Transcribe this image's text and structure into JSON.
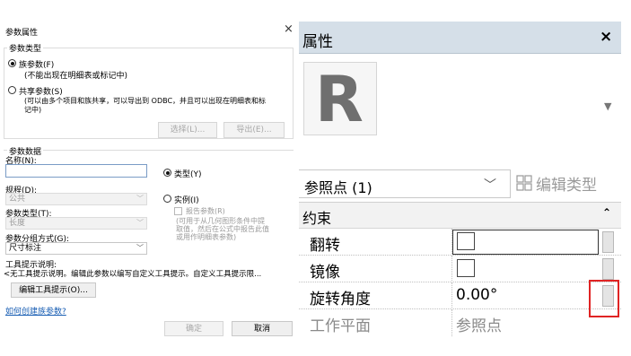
{
  "dialog": {
    "title": "参数属性",
    "close_glyph": "×",
    "param_type_group": "参数类型",
    "family_param": "族参数(F)",
    "family_param_note": "(不能出现在明细表或标记中)",
    "shared_param": "共享参数(S)",
    "shared_param_note_line1": "(可以由多个项目和族共享，可以导出到 ODBC，并且可以出现在明细表和标",
    "shared_param_note_line2": "记中)",
    "select_button": "选择(L)...",
    "export_button": "导出(E)...",
    "param_data_group": "参数数据",
    "name_label": "名称(N):",
    "name_value": "",
    "type_radio": "类型(Y)",
    "discipline_label": "规程(D):",
    "discipline_value": "公共",
    "instance_radio": "实例(I)",
    "param_type_label": "参数类型(T):",
    "param_type_value": "长度",
    "report_param": "报告参数(R)",
    "report_note_line1": "(可用于从几何图形条件中提",
    "report_note_line2": "取值，然后在公式中报告此值",
    "report_note_line3": "或用作明细表参数)",
    "group_label": "参数分组方式(G):",
    "group_value": "尺寸标注",
    "tooltip_label": "工具提示说明:",
    "tooltip_value": "<无工具提示说明。编辑此参数以编写自定义工具提示。自定义工具提示限...",
    "edit_tooltip_button": "编辑工具提示(O)...",
    "help_link": "如何创建族参数?",
    "ok_button": "确定",
    "cancel_button": "取消"
  },
  "properties": {
    "title": "属性",
    "close_glyph": "×",
    "logo_letter": "R",
    "type_selector": "参照点 (1)",
    "edit_type": "编辑类型",
    "section": "约束",
    "rows": [
      {
        "name": "翻转",
        "value": ""
      },
      {
        "name": "镜像",
        "value": ""
      },
      {
        "name": "旋转角度",
        "value": "0.00°"
      },
      {
        "name": "工作平面",
        "value": "参照点"
      }
    ]
  }
}
